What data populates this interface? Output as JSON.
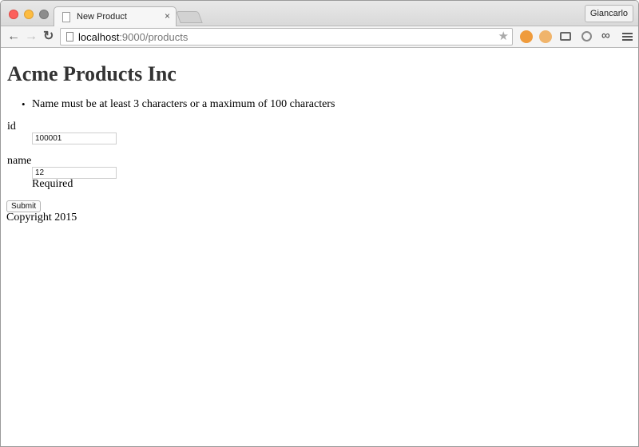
{
  "browser": {
    "tab_title": "New Product",
    "tab_close": "×",
    "profile_name": "Giancarlo",
    "url_host": "localhost",
    "url_path": ":9000/products",
    "back_glyph": "←",
    "forward_glyph": "→",
    "reload_glyph": "↻",
    "star_glyph": "★",
    "icons": [
      "back-icon",
      "forward-icon",
      "reload-icon",
      "page-icon",
      "star-icon",
      "extension-icon",
      "cast-icon",
      "menu-icon"
    ]
  },
  "page": {
    "title": "Acme Products Inc",
    "errors": [
      "Name must be at least 3 characters or a maximum of 100 characters"
    ],
    "form": {
      "id_label": "id",
      "id_value": "100001",
      "name_label": "name",
      "name_value": "12",
      "name_help": "Required",
      "submit_label": "Submit"
    },
    "footer": "Copyright 2015"
  },
  "colors": {
    "traffic_close": "#fc605c",
    "traffic_min": "#fdbc40",
    "title_text": "#333333"
  }
}
